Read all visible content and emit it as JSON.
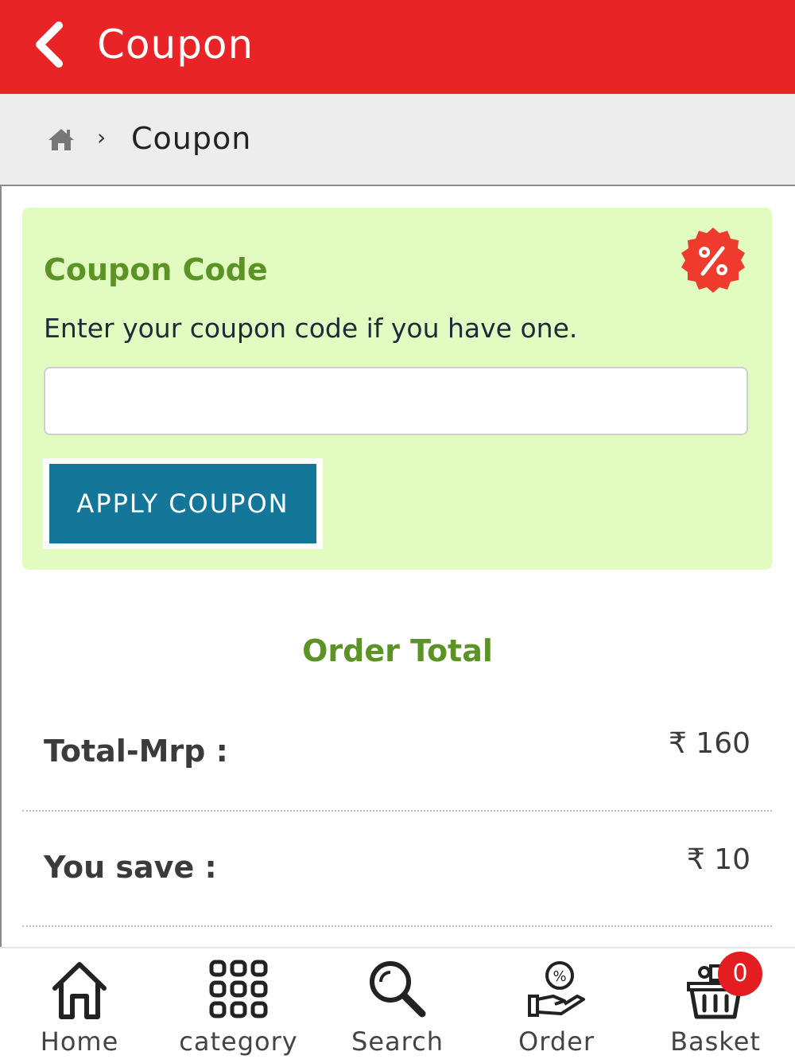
{
  "header": {
    "title": "Coupon",
    "back_icon": "back-chevron-icon",
    "color": "#e92427"
  },
  "breadcrumb": {
    "home_icon": "home-icon",
    "separator": "›",
    "current": "Coupon"
  },
  "coupon": {
    "title": "Coupon Code",
    "subtitle": "Enter your coupon code if you have one.",
    "input_value": "",
    "input_placeholder": "",
    "apply_label": "APPLY COUPON",
    "badge_icon": "percent-badge-icon",
    "card_color": "#e1fbc1",
    "button_color": "#147699"
  },
  "order": {
    "title": "Order Total",
    "rows": [
      {
        "label": "Total-Mrp :",
        "value": "₹ 160"
      },
      {
        "label": "You save :",
        "value": "₹ 10"
      }
    ]
  },
  "nav": {
    "items": [
      {
        "label": "Home",
        "icon": "home-icon"
      },
      {
        "label": "category",
        "icon": "category-grid-icon"
      },
      {
        "label": "Search",
        "icon": "search-icon"
      },
      {
        "label": "Order",
        "icon": "order-icon"
      },
      {
        "label": "Basket",
        "icon": "basket-icon"
      }
    ],
    "basket_count": "0"
  }
}
